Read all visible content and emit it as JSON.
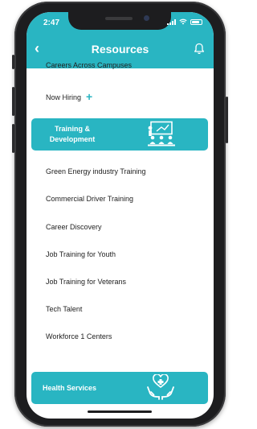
{
  "status_bar": {
    "time": "2:47"
  },
  "header": {
    "title": "Resources"
  },
  "list": {
    "partial_item": "Careers Across Campuses",
    "now_hiring": "Now Hiring"
  },
  "categories": {
    "training": {
      "label_line1": "Training &",
      "label_line2": "Development"
    },
    "health": {
      "label": "Health Services"
    }
  },
  "training_items": [
    "Green Energy industry Training",
    "Commercial Driver Training",
    "Career Discovery",
    "Job Training for Youth",
    "Job Training for Veterans",
    "Tech Talent",
    "Workforce 1 Centers"
  ],
  "colors": {
    "accent": "#29b5c2",
    "phone_frame": "#1d1d1f"
  }
}
